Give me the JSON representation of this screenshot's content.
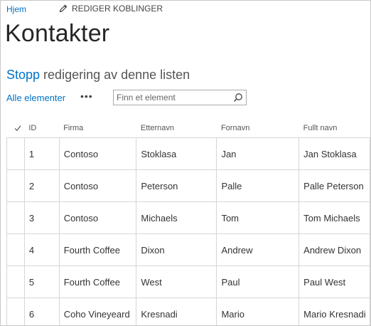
{
  "nav": {
    "home": "Hjem",
    "edit_links": "REDIGER KOBLINGER"
  },
  "page": {
    "title": "Kontakter"
  },
  "edit_mode": {
    "stop": "Stopp",
    "rest": " redigering av denne listen"
  },
  "view": {
    "all_items": "Alle elementer",
    "more": "•••",
    "search_placeholder": "Finn et element"
  },
  "table": {
    "columns": [
      "ID",
      "Firma",
      "Etternavn",
      "Fornavn",
      "Fullt navn"
    ],
    "rows": [
      [
        "1",
        "Contoso",
        "Stoklasa",
        "Jan",
        "Jan Stoklasa"
      ],
      [
        "2",
        "Contoso",
        "Peterson",
        "Palle",
        "Palle Peterson"
      ],
      [
        "3",
        "Contoso",
        "Michaels",
        "Tom",
        "Tom Michaels"
      ],
      [
        "4",
        "Fourth Coffee",
        "Dixon",
        "Andrew",
        "Andrew Dixon"
      ],
      [
        "5",
        "Fourth Coffee",
        "West",
        "Paul",
        "Paul West"
      ],
      [
        "6",
        "Coho Vineyeard",
        "Kresnadi",
        "Mario",
        "Mario Kresnadi"
      ]
    ]
  },
  "colors": {
    "accent": "#0072c6",
    "text": "#333333",
    "grid_line": "#d6d6d6"
  },
  "icons": {
    "edit": "pencil-icon",
    "search": "search-icon",
    "select_all": "checkmark-icon"
  }
}
